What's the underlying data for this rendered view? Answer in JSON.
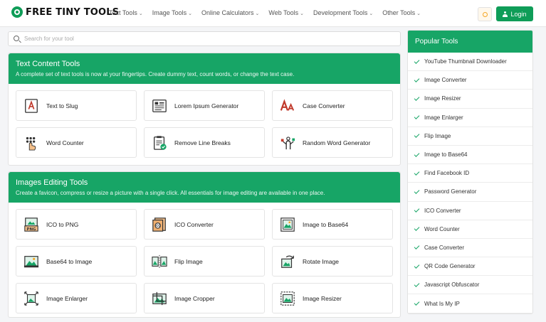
{
  "header": {
    "logo_text": "FREE TINY TOOLS",
    "nav": [
      {
        "label": "Text Tools"
      },
      {
        "label": "Image Tools"
      },
      {
        "label": "Online Calculators"
      },
      {
        "label": "Web Tools"
      },
      {
        "label": "Development Tools"
      },
      {
        "label": "Other Tools"
      }
    ],
    "login_label": "Login",
    "colors": {
      "brand": "#0f9d58",
      "accent": "#17a566"
    }
  },
  "search": {
    "placeholder": "Search for your tool",
    "value": ""
  },
  "text_section": {
    "title": "Text Content Tools",
    "description": "A complete set of text tools is now at your fingertips. Create dummy text, count words, or change the text case.",
    "tools": [
      {
        "label": "Text to Slug",
        "icon": "text-slug-icon"
      },
      {
        "label": "Lorem Ipsum Generator",
        "icon": "lorem-document-icon"
      },
      {
        "label": "Case Converter",
        "icon": "case-aa-icon"
      },
      {
        "label": "Word Counter",
        "icon": "counter-hand-icon"
      },
      {
        "label": "Remove Line Breaks",
        "icon": "clipboard-check-icon"
      },
      {
        "label": "Random Word Generator",
        "icon": "random-word-icon"
      }
    ]
  },
  "image_section": {
    "title": "Images Editing Tools",
    "description": "Create a favicon, compress or resize a picture with a single click. All essentials for image editing are available in one place.",
    "tools": [
      {
        "label": "ICO to PNG",
        "icon": "png-file-icon"
      },
      {
        "label": "ICO Converter",
        "icon": "ico-converter-icon"
      },
      {
        "label": "Image to Base64",
        "icon": "image-frame-icon"
      },
      {
        "label": "Base64 to Image",
        "icon": "base64-image-icon"
      },
      {
        "label": "Flip Image",
        "icon": "flip-image-icon"
      },
      {
        "label": "Rotate Image",
        "icon": "rotate-image-icon"
      },
      {
        "label": "Image Enlarger",
        "icon": "enlarge-image-icon"
      },
      {
        "label": "Image Cropper",
        "icon": "crop-image-icon"
      },
      {
        "label": "Image Resizer",
        "icon": "resize-image-icon"
      }
    ]
  },
  "sidebar": {
    "title": "Popular Tools",
    "items": [
      {
        "label": "YouTube Thumbnail Downloader"
      },
      {
        "label": "Image Converter"
      },
      {
        "label": "Image Resizer"
      },
      {
        "label": "Image Enlarger"
      },
      {
        "label": "Flip Image"
      },
      {
        "label": "Image to Base64"
      },
      {
        "label": "Find Facebook ID"
      },
      {
        "label": "Password Generator"
      },
      {
        "label": "ICO Converter"
      },
      {
        "label": "Word Counter"
      },
      {
        "label": "Case Converter"
      },
      {
        "label": "QR Code Generator"
      },
      {
        "label": "Javascript Obfuscator"
      },
      {
        "label": "What Is My IP"
      }
    ]
  }
}
